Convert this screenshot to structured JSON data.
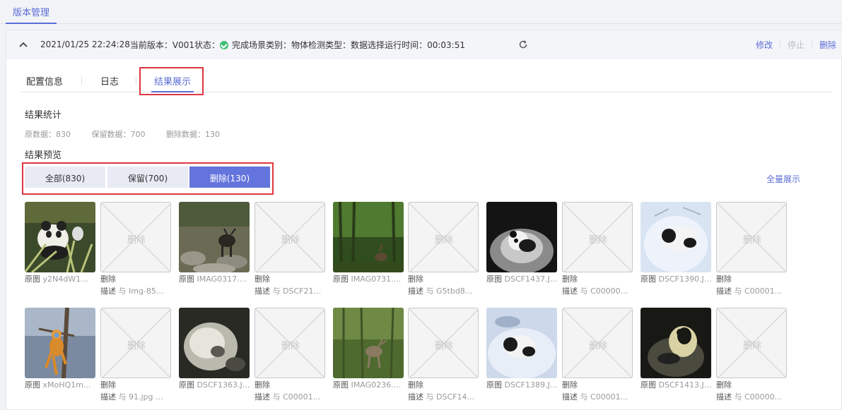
{
  "top_tab": "版本管理",
  "info": {
    "datetime": "2021/01/25 22:24:28",
    "version": "当前版本：V001",
    "status_label": "状态：",
    "status_value": "完成",
    "scene": "场景类别：物体检测",
    "type": "类型：数据选择",
    "runtime": "运行时间：00:03:51"
  },
  "actions": {
    "edit": "修改",
    "stop": "停止",
    "delete": "删除"
  },
  "tabs": [
    "配置信息",
    "日志",
    "结果展示"
  ],
  "stats_title": "结果统计",
  "stats": {
    "raw": "原数据：830",
    "kept": "保留数据：700",
    "deleted": "删除数据：130"
  },
  "preview_title": "结果预览",
  "filters": {
    "all": "全部(830)",
    "keep": "保留(700)",
    "del": "删除(130)"
  },
  "full_view": "全量展示",
  "placeholder_text": "删除",
  "cards": [
    {
      "kind": "orig",
      "theme": "panda-bamboo",
      "l1k": "原图",
      "l1v": "y2N4dW1..."
    },
    {
      "kind": "del",
      "l1k": "删除",
      "l2k": "描述",
      "l2v": "与 Img-85..."
    },
    {
      "kind": "orig",
      "theme": "takin-rocks",
      "l1k": "原图",
      "l1v": "IMAG0317...."
    },
    {
      "kind": "del",
      "l1k": "删除",
      "l2k": "描述",
      "l2v": "与 DSCF21..."
    },
    {
      "kind": "orig",
      "theme": "forest-deer",
      "l1k": "原图",
      "l1v": "IMAG0731...."
    },
    {
      "kind": "del",
      "l1k": "删除",
      "l2k": "描述",
      "l2v": "与 G5tbd8..."
    },
    {
      "kind": "orig",
      "theme": "panda-night-snow",
      "l1k": "原图",
      "l1v": "DSCF1437.J..."
    },
    {
      "kind": "del",
      "l1k": "删除",
      "l2k": "描述",
      "l2v": "与 C00000..."
    },
    {
      "kind": "orig",
      "theme": "panda-snow",
      "l1k": "原图",
      "l1v": "DSCF1390.J..."
    },
    {
      "kind": "del",
      "l1k": "删除",
      "l2k": "描述",
      "l2v": "与 C00001..."
    },
    {
      "kind": "orig",
      "theme": "monkey-tree",
      "l1k": "原图",
      "l1v": "xMoHQ1m..."
    },
    {
      "kind": "del",
      "l1k": "删除",
      "l2k": "描述",
      "l2v": "与 91.jpg ..."
    },
    {
      "kind": "orig",
      "theme": "night-snow-blur",
      "l1k": "原图",
      "l1v": "DSCF1363.J..."
    },
    {
      "kind": "del",
      "l1k": "删除",
      "l2k": "描述",
      "l2v": "与 C00001..."
    },
    {
      "kind": "orig",
      "theme": "forest-deer-2",
      "l1k": "原图",
      "l1v": "IMAG0236...."
    },
    {
      "kind": "del",
      "l1k": "删除",
      "l2k": "描述",
      "l2v": "与 DSCF14..."
    },
    {
      "kind": "orig",
      "theme": "panda-snow-2",
      "l1k": "原图",
      "l1v": "DSCF1389.J..."
    },
    {
      "kind": "del",
      "l1k": "删除",
      "l2k": "描述",
      "l2v": "与 C00001..."
    },
    {
      "kind": "orig",
      "theme": "panda-night-2",
      "l1k": "原图",
      "l1v": "DSCF1413.J..."
    },
    {
      "kind": "del",
      "l1k": "删除",
      "l2k": "描述",
      "l2v": "与 C00000..."
    }
  ],
  "colors": {
    "accent": "#5c6dd6",
    "filter_active": "#6474dd",
    "success": "#3fbf74",
    "highlight": "#e0353f"
  }
}
